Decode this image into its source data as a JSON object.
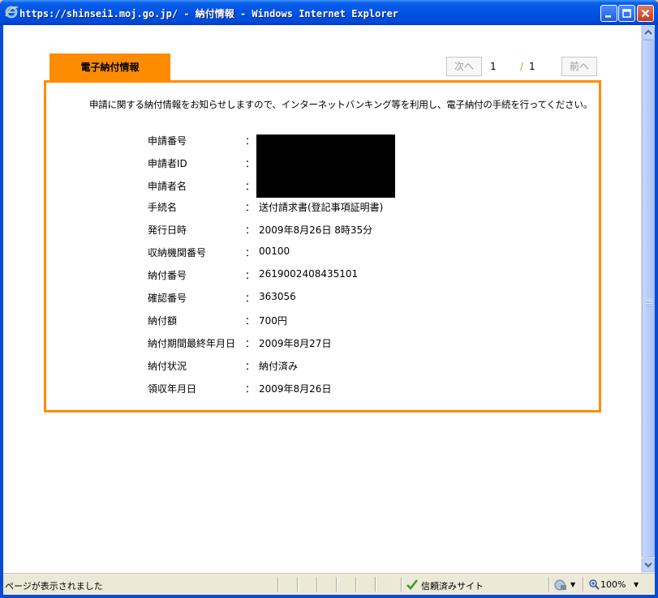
{
  "window": {
    "title": "https://shinsei1.moj.go.jp/ - 納付情報 - Windows Internet Explorer"
  },
  "tab": {
    "label": "電子納付情報"
  },
  "pager": {
    "next_label": "次へ",
    "current": "1",
    "separator": "/",
    "total": "1",
    "prev_label": "前へ"
  },
  "notice": "申請に関する納付情報をお知らせしますので、インターネットバンキング等を利用し、電子納付の手続を行ってください。",
  "colon": "：",
  "fields": [
    {
      "label": "申請番号",
      "value": ""
    },
    {
      "label": "申請者ID",
      "value": ""
    },
    {
      "label": "申請者名",
      "value": ""
    },
    {
      "label": "手続名",
      "value": "送付請求書(登記事項証明書)"
    },
    {
      "label": "発行日時",
      "value": "2009年8月26日 8時35分"
    },
    {
      "label": "収納機関番号",
      "value": "00100"
    },
    {
      "label": "納付番号",
      "value": "2619002408435101"
    },
    {
      "label": "確認番号",
      "value": "363056"
    },
    {
      "label": "納付額",
      "value": "700円"
    },
    {
      "label": "納付期間最終年月日",
      "value": "2009年8月27日"
    },
    {
      "label": "納付状況",
      "value": "納付済み"
    },
    {
      "label": "領収年月日",
      "value": "2009年8月26日"
    }
  ],
  "statusbar": {
    "status": "ページが表示されました",
    "zone": "信頼済みサイト",
    "zoom": "100%"
  },
  "icons": {
    "ie": "ie-logo-icon",
    "trust": "checkmark-icon",
    "globe": "protected-mode-icon",
    "zoom": "magnifier-icon"
  },
  "colors": {
    "accent": "#ff8c00",
    "titlebar": "#0055e5"
  }
}
